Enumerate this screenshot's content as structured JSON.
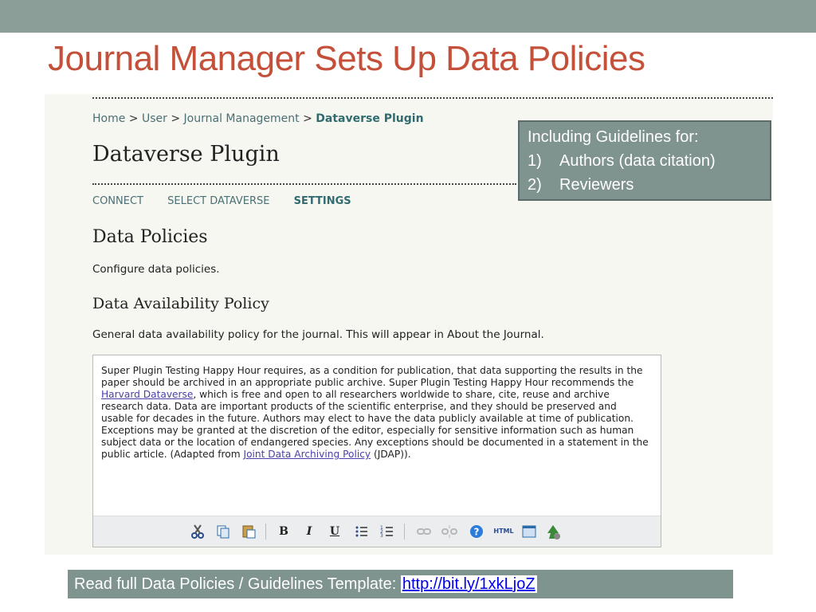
{
  "slide": {
    "title": "Journal Manager Sets Up Data Policies"
  },
  "breadcrumb": {
    "home": "Home",
    "user": "User",
    "journal_management": "Journal Management",
    "current": "Dataverse Plugin",
    "separator": ">"
  },
  "plugin": {
    "title": "Dataverse Plugin"
  },
  "tabs": [
    {
      "label": "CONNECT"
    },
    {
      "label": "SELECT DATAVERSE"
    },
    {
      "label": "SETTINGS"
    }
  ],
  "section": {
    "heading": "Data Policies",
    "description": "Configure data policies.",
    "subheading": "Data Availability Policy",
    "subdescription": "General data availability policy for the journal. This will appear in About the Journal."
  },
  "editor": {
    "text_1": "Super Plugin Testing Happy Hour requires, as a condition for publication, that data supporting the results in the paper should be archived in an appropriate public archive. Super Plugin Testing Happy Hour recommends the ",
    "link_1": "Harvard Dataverse",
    "text_2": ", which is free and open to all researchers worldwide to share, cite, reuse and archive research data. Data are important products of the scientific enterprise, and they should be preserved and usable for decades in the future. Authors may elect to have the data publicly available at time of publication. Exceptions may be granted at the discretion of the editor, especially for sensitive information such as human subject data or the location of endangered species. Any exceptions should be documented in a statement in the public article. (Adapted from ",
    "link_2": "Joint Data Archiving Policy",
    "text_3": " (JDAP)).",
    "toolbar": {
      "bold": "B",
      "italic": "I",
      "underline": "U",
      "html": "HTML"
    }
  },
  "callout": {
    "heading": "Including Guidelines for:",
    "items": [
      {
        "num": "1)",
        "text": "Authors (data citation)"
      },
      {
        "num": "2)",
        "text": "Reviewers"
      }
    ]
  },
  "footer": {
    "text": "Read full Data Policies / Guidelines Template: ",
    "link": "http://bit.ly/1xkLjoZ"
  },
  "colors": {
    "title": "#c5503a",
    "bar": "#8c9e98",
    "callout_bg": "#7f938f"
  }
}
